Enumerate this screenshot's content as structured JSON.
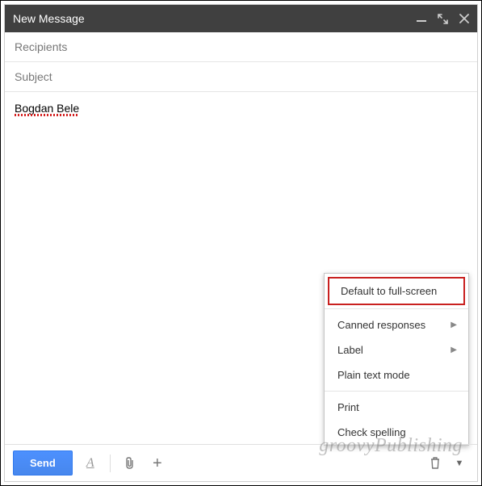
{
  "header": {
    "title": "New Message"
  },
  "fields": {
    "recipients_placeholder": "Recipients",
    "subject_placeholder": "Subject"
  },
  "body": {
    "typed_text": "Bogdan Bele"
  },
  "menu": {
    "default_full_screen": "Default to full-screen",
    "canned_responses": "Canned responses",
    "label": "Label",
    "plain_text": "Plain text mode",
    "print": "Print",
    "check_spelling": "Check spelling"
  },
  "toolbar": {
    "send_label": "Send",
    "format_label": "A",
    "plus_label": "+"
  },
  "watermark": "groovyPublishing"
}
